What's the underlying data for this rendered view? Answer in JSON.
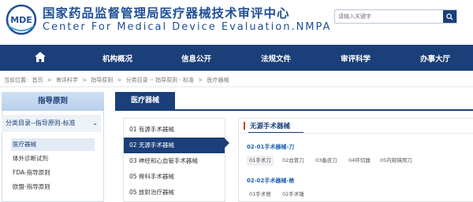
{
  "header": {
    "logo_text": "MDE",
    "title_cn": "国家药品监督管理局医疗器械技术审评中心",
    "title_en": "Center For Medical Device Evaluation.NMPA",
    "search_placeholder": "请输入关键字"
  },
  "nav": {
    "items": [
      "机构概况",
      "信息公开",
      "法规文件",
      "审评科学",
      "办事大厅"
    ]
  },
  "breadcrumb": {
    "label": "当前位置:",
    "items": [
      "首页",
      ">",
      "审评科学",
      ">",
      "指导原则",
      ">",
      "分类目录 -- 指导原则 - 标准",
      ">",
      "医疗器械"
    ]
  },
  "sidebar": {
    "heading": "指导原则",
    "category": "分类目录--指导原则-标准",
    "items": [
      "医疗器械",
      "体外诊断试剂",
      "FDA-指导原则",
      "欧盟-指导原则"
    ]
  },
  "main": {
    "tab": "医疗器械",
    "list": [
      "01 有源手术器械",
      "02 无源手术器械",
      "03 神经和心血管手术器械",
      "05 骨科手术器械",
      "05 放射治疗器械"
    ],
    "panel_title": "无源手术器械",
    "sections": [
      {
        "title": "02-01手术器械-刀",
        "chips": [
          "01手术刀",
          "02血管刀",
          "03备皮刀",
          "04环切器",
          "05内窥镜用刀"
        ]
      },
      {
        "title": "02-02手术器械-凿",
        "chips": [
          "01手术凿",
          "02手术锤"
        ]
      }
    ]
  },
  "colors": {
    "brand": "#1b3f78",
    "accent": "#d43a2f",
    "link": "#1f5fb4"
  }
}
